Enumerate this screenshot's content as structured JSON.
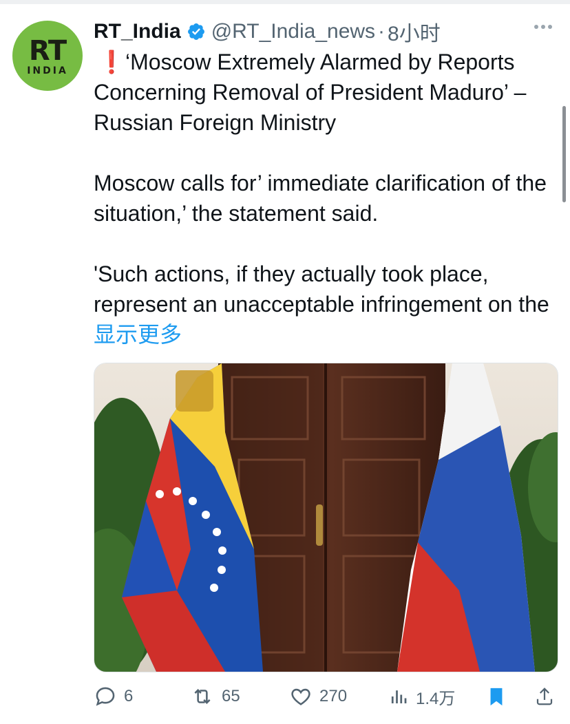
{
  "tweet": {
    "author_name": "RT_India",
    "handle": "@RT_India_news",
    "separator": "·",
    "time": "8小时",
    "avatar_line1": "RT",
    "avatar_line2": "INDIA",
    "exclamation": "❗",
    "paragraph1": "‘Moscow Extremely Alarmed by Reports Concerning Removal of President Maduro’ – Russian Foreign Ministry",
    "paragraph2": "Moscow calls for’ immediate clarification of the situation,’ the statement said.",
    "paragraph3": "'Such actions, if they actually took place, represent an unacceptable infringement on the",
    "show_more": "显示更多"
  },
  "actions": {
    "replies": "6",
    "retweets": "65",
    "likes": "270",
    "views": "1.4万"
  },
  "colors": {
    "accent": "#1d9bf0",
    "text": "#0f1419",
    "muted": "#536471",
    "avatar_bg": "#77bc43"
  },
  "icons": [
    "verified-badge-icon",
    "more-options-icon",
    "reply-icon",
    "retweet-icon",
    "like-icon",
    "views-icon",
    "bookmark-icon",
    "share-icon"
  ]
}
